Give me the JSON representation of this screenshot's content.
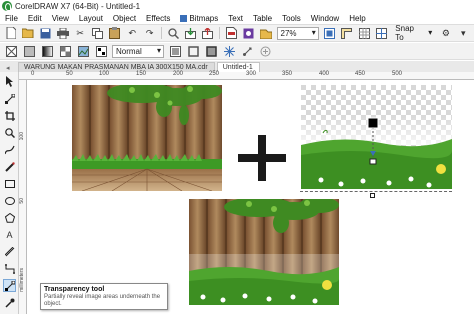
{
  "window": {
    "title": "CorelDRAW X7 (64-Bit) - Untitled-1"
  },
  "menu": {
    "items": [
      "File",
      "Edit",
      "View",
      "Layout",
      "Object",
      "Effects",
      "Bitmaps",
      "Text",
      "Table",
      "Tools",
      "Window",
      "Help"
    ]
  },
  "toolbar": {
    "zoom_value": "27%",
    "snap_label": "Snap To"
  },
  "property_bar": {
    "mode_value": "Normal"
  },
  "tabs": [
    {
      "label": "WARUNG MAKAN PRASMANAN MBA IA 300X150 MA.cdr"
    },
    {
      "label": "Untitled-1"
    }
  ],
  "ruler": {
    "h_labels": [
      "0",
      "50",
      "100",
      "150",
      "200",
      "250",
      "300",
      "350",
      "400",
      "450",
      "500"
    ],
    "v_labels": [
      "100",
      "50",
      "millimeters"
    ]
  },
  "tooltip": {
    "title": "Transparency tool",
    "description": "Partially reveal image areas underneath the object."
  },
  "colors": {
    "accent": "#3a6fb8",
    "plus": "#1a1a1a",
    "grass": "#3f9a2a",
    "wood": "#a0774c"
  }
}
